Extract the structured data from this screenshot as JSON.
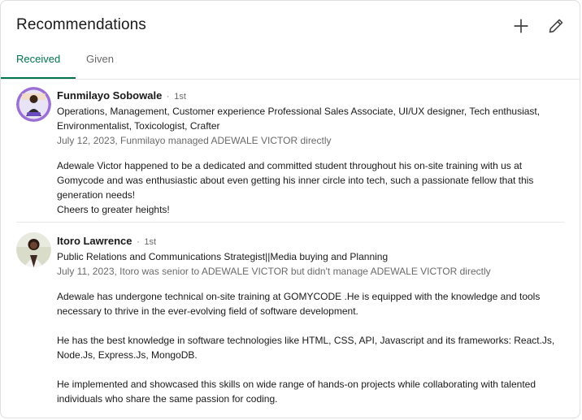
{
  "header": {
    "title": "Recommendations",
    "add_icon": "plus-icon",
    "edit_icon": "pencil-icon"
  },
  "tabs": [
    {
      "label": "Received",
      "active": true
    },
    {
      "label": "Given",
      "active": false
    }
  ],
  "colors": {
    "accent": "#01754f",
    "divider": "#e8e8e8",
    "muted_text": "#666666"
  },
  "recommendations": [
    {
      "name": "Funmilayo Sobowale",
      "separator": "·",
      "degree": "1st",
      "headline_lines": [
        "Operations, Management, Customer experience Professional Sales Associate, UI/UX designer, Tech enthusiast,",
        "Environmentalist, Toxicologist, Crafter"
      ],
      "meta": "July 12, 2023, Funmilayo managed ADEWALE VICTOR directly",
      "body_lines": [
        "Adewale Victor happened to be a dedicated and committed student throughout his on-site training with us at",
        "Gomycode and was enthusiastic about even getting his inner circle into tech, such a passionate fellow that this",
        "generation needs!",
        "Cheers to greater heights!"
      ]
    },
    {
      "name": "Itoro Lawrence",
      "separator": "·",
      "degree": "1st",
      "headline_lines": [
        "Public Relations and Communications Strategist||Media buying and Planning"
      ],
      "meta": "July 11, 2023, Itoro was senior to ADEWALE VICTOR but didn't manage ADEWALE VICTOR directly",
      "body_lines": [
        "Adewale has undergone technical on-site training at GOMYCODE .He is equipped with the knowledge and tools",
        "necessary to thrive in the ever-evolving field of software development.",
        "",
        "He has the best knowledge in software technologies like HTML, CSS, API, Javascript and its frameworks: React.Js,",
        "Node.Js, Express.Js, MongoDB.",
        "",
        "He implemented and showcased this skills on wide range of hands-on projects while collaborating with talented",
        "individuals who share the same passion for coding."
      ]
    }
  ]
}
